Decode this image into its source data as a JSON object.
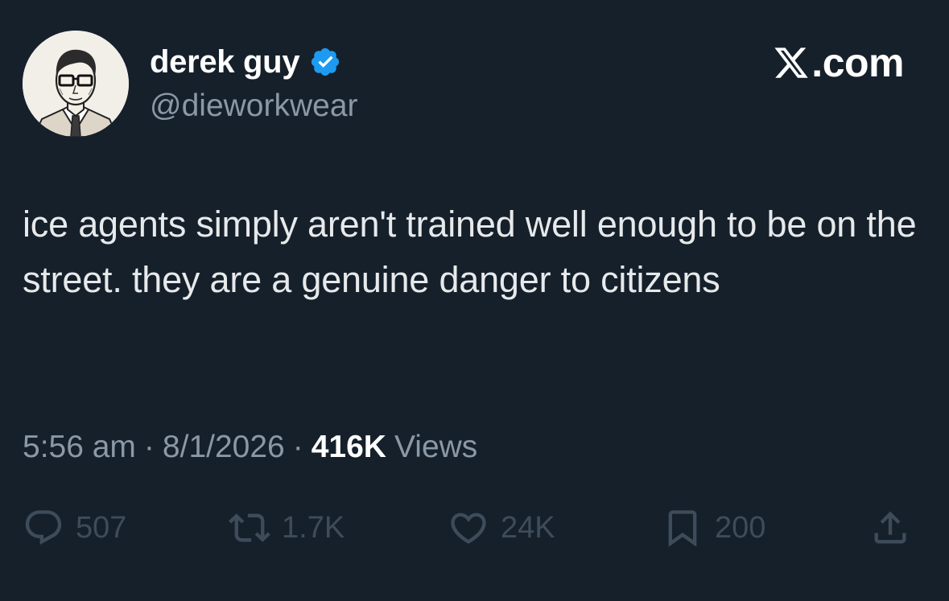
{
  "author": {
    "display_name": "derek guy",
    "handle": "@dieworkwear",
    "verified": true
  },
  "brand": {
    "label": ".com"
  },
  "tweet": {
    "text": "ice agents simply aren't trained well enough to be on the street. they are a genuine danger to citizens"
  },
  "meta": {
    "time": "5:56 am",
    "date": "8/1/2026",
    "separator": "·",
    "views_count": "416K",
    "views_label": "Views"
  },
  "actions": {
    "replies": "507",
    "retweets": "1.7K",
    "likes": "24K",
    "bookmarks": "200"
  },
  "colors": {
    "background": "#15202b",
    "primary_text": "#e7e9ea",
    "secondary_text": "#8b98a5",
    "verified": "#1d9bf0",
    "action_icons": "#3e4c5a"
  },
  "icons": {
    "verified": "verified-badge-icon",
    "brand": "x-logo-icon",
    "reply": "reply-icon",
    "retweet": "retweet-icon",
    "like": "heart-icon",
    "bookmark": "bookmark-icon",
    "share": "share-icon"
  }
}
